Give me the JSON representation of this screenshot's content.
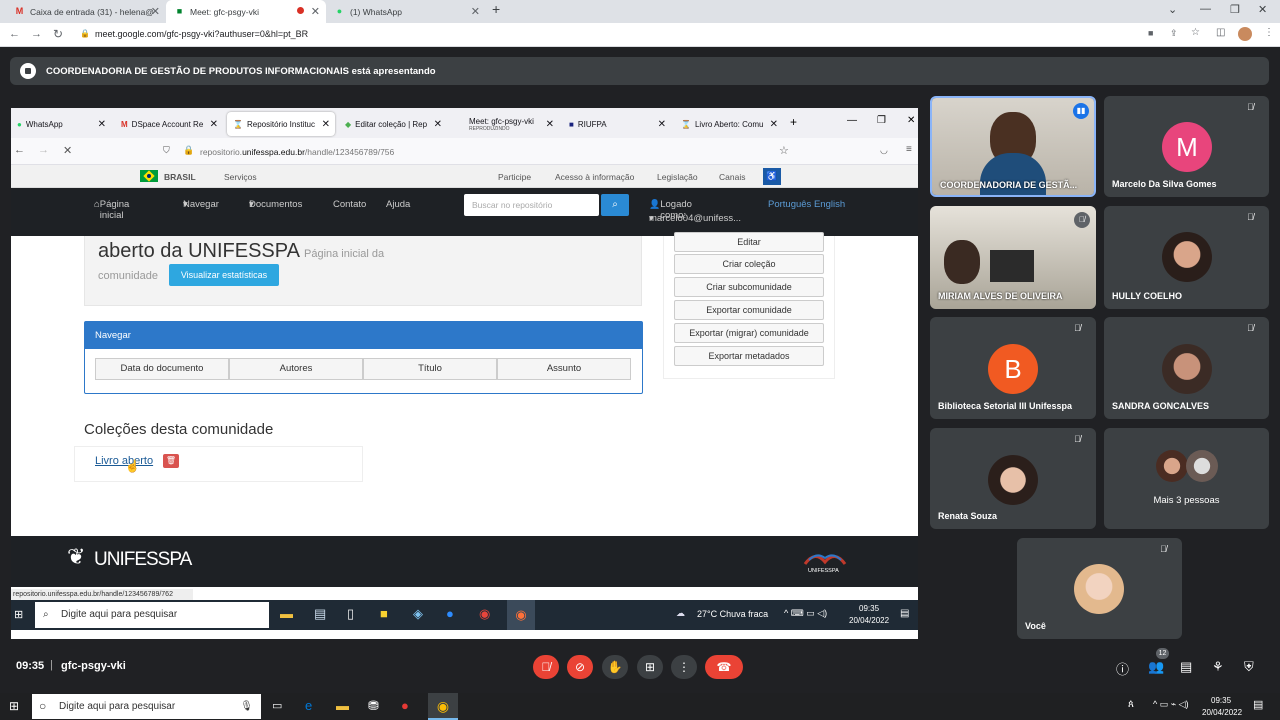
{
  "browser": {
    "tabs": [
      {
        "label": "Caixa de entrada (31) - helena@",
        "icon": "gmail-icon"
      },
      {
        "label": "Meet: gfc-psgy-vki",
        "icon": "meet-icon"
      },
      {
        "label": "(1) WhatsApp",
        "icon": "whatsapp-icon"
      }
    ],
    "url": "meet.google.com/gfc-psgy-vki?authuser=0&hl=pt_BR"
  },
  "banner": {
    "text": "COORDENADORIA DE GESTÃO DE PRODUTOS INFORMACIONAIS está apresentando"
  },
  "shared": {
    "ff_tabs": [
      {
        "label": "WhatsApp"
      },
      {
        "label": "DSpace Account Re"
      },
      {
        "label": "Repositório Instituc"
      },
      {
        "label": "Editar coleção | Rep"
      },
      {
        "label": "Meet: gfc-psgy-vki"
      },
      {
        "label": "RIUFPA"
      },
      {
        "label": "Livro Aberto: Comu"
      }
    ],
    "ff_tab_sub": "REPRODUZINDO",
    "ff_url_prefix": "repositorio.",
    "ff_url_domain": "unifesspa.edu.br",
    "ff_url_path": "/handle/123456789/756",
    "gov": {
      "brasil": "BRASIL",
      "servicos": "Serviços",
      "links": [
        "Participe",
        "Acesso à informação",
        "Legislação",
        "Canais"
      ]
    },
    "dsnav": {
      "home": "Página inicial",
      "navegar": "Navegar",
      "documentos": "Documentos",
      "contato": "Contato",
      "ajuda": "Ajuda",
      "search_placeholder": "Buscar no repositório",
      "logged_label": "Logado como:",
      "logged_user": "marcelo04@unifess...",
      "lang": "Português English"
    },
    "community": {
      "title_main": "aberto da UNIFESSPA",
      "title_sub1": "Página inicial da",
      "title_sub2": "comunidade",
      "stats_button": "Visualizar estatísticas"
    },
    "side_buttons": [
      "Editar",
      "Criar coleção",
      "Criar subcomunidade",
      "Exportar comunidade",
      "Exportar (migrar) comunidade",
      "Exportar metadados"
    ],
    "browse": {
      "header": "Navegar",
      "buttons": [
        "Data do documento",
        "Autores",
        "Título",
        "Assunto"
      ]
    },
    "collections": {
      "heading": "Coleções desta comunidade",
      "item": "Livro aberto"
    },
    "footer": {
      "logo": "UNIFESSPA",
      "logo_right": "UNIFESSPA"
    },
    "status_url": "repositorio.unifesspa.edu.br/handle/123456789/762",
    "taskbar": {
      "search": "Digite aqui para pesquisar",
      "weather": "27°C  Chuva fraca",
      "time": "09:35",
      "date": "20/04/2022"
    }
  },
  "participants": [
    {
      "name": "COORDENADORIA DE GESTÃ...",
      "speaking": true
    },
    {
      "name": "Marcelo Da Silva Gomes",
      "initial": "M",
      "color": "#e8457c"
    },
    {
      "name": "MIRIAM ALVES DE OLIVEIRA"
    },
    {
      "name": "HULLY COELHO"
    },
    {
      "name": "Biblioteca Setorial III Unifesspa",
      "initial": "B",
      "color": "#f15a22"
    },
    {
      "name": "SANDRA GONCALVES"
    },
    {
      "name": "Renata Souza"
    },
    {
      "name": "Mais 3 pessoas"
    },
    {
      "name": "Você"
    }
  ],
  "meeting": {
    "time": "09:35",
    "code": "gfc-psgy-vki",
    "people_count": "12"
  },
  "os_taskbar": {
    "search": "Digite aqui para pesquisar",
    "time": "09:35",
    "date": "20/04/2022"
  }
}
